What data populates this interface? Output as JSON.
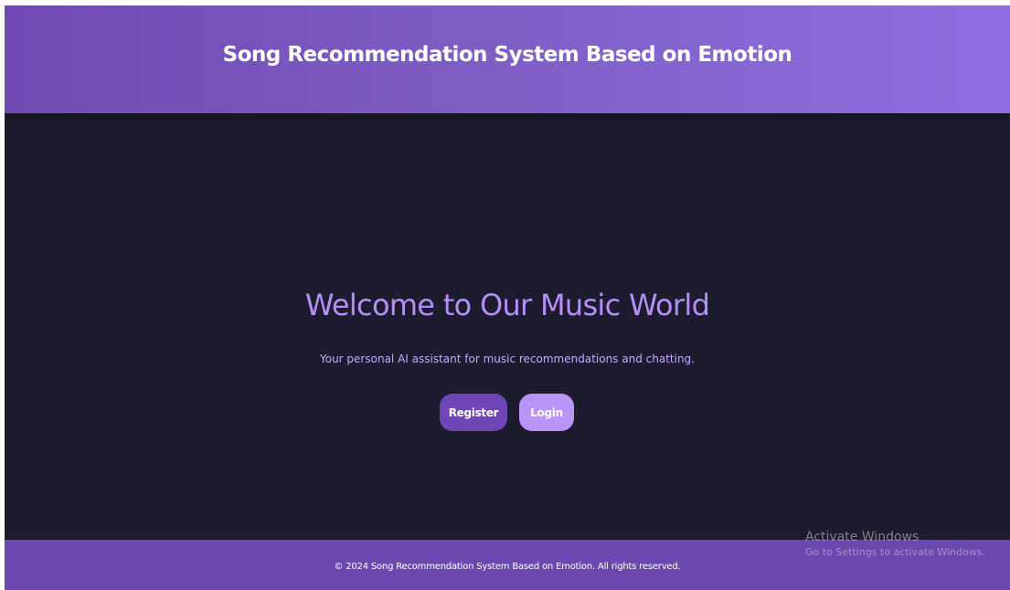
{
  "header": {
    "title": "Song Recommendation System Based on Emotion"
  },
  "main": {
    "welcome": "Welcome to Our Music World",
    "tagline": "Your personal AI assistant for music recommendations and chatting.",
    "register_label": "Register",
    "login_label": "Login"
  },
  "footer": {
    "copyright": "© 2024 Song Recommendation System Based on Emotion. All rights reserved."
  },
  "watermark": {
    "title": "Activate Windows",
    "subtitle": "Go to Settings to activate Windows."
  },
  "colors": {
    "header_gradient_start": "#6f4ab3",
    "header_gradient_end": "#8f6fe0",
    "background": "#1c1c2e",
    "welcome_text": "#b58ef7",
    "register_button": "#6f46b8",
    "login_button": "#b794f5",
    "footer": "#6c48b1"
  }
}
